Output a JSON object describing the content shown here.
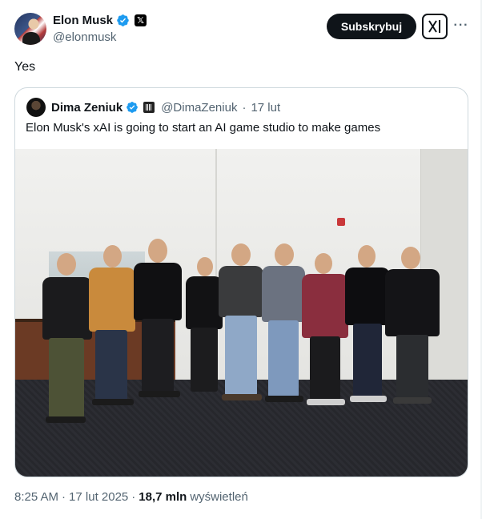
{
  "post": {
    "author_name": "Elon Musk",
    "author_handle": "@elonmusk",
    "subscribe_label": "Subskrybuj",
    "text": "Yes"
  },
  "quote": {
    "author_name": "Dima Zeniuk",
    "author_handle": "@DimaZeniuk",
    "separator": "·",
    "date": "17 lut",
    "text": "Elon Musk's xAI is going to start an AI game studio to make games"
  },
  "footer": {
    "time": "8:25 AM",
    "separator": "·",
    "date": "17 lut 2025",
    "views_count": "18,7 mln",
    "views_label": "wyświetleń"
  },
  "colors": {
    "verified_blue": "#1d9bf0",
    "text_primary": "#0f1419",
    "text_secondary": "#536471",
    "border": "#cfd9de"
  },
  "icons": [
    "verified-badge-icon",
    "x-affiliate-badge-icon",
    "xai-logo-icon",
    "more-options-icon",
    "flag-badge-icon"
  ]
}
